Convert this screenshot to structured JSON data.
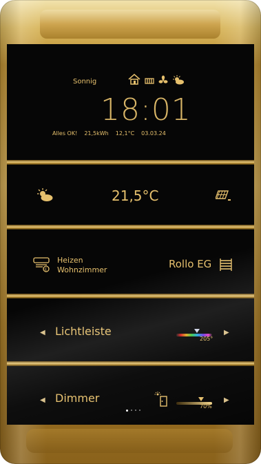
{
  "header": {
    "condition": "Sonnig",
    "time": "18:01",
    "status": "Alles OK!",
    "energy": "21,5kWh",
    "outdoor_temp": "12,1°C",
    "date": "03.03.24",
    "icons": [
      "home-icon",
      "heater-icon",
      "fan-icon",
      "partly-sunny-icon"
    ]
  },
  "climate": {
    "temperature": "21,5°C",
    "left_icon": "partly-sunny-icon",
    "right_icon": "solar-panel-icon"
  },
  "controls": {
    "heating_label_line1": "Heizen",
    "heating_label_line2": "Wohnzimmer",
    "shutter_label": "Rollo EG",
    "heating_icon": "heating-icon",
    "shutter_icon": "shutter-icon"
  },
  "light_strip": {
    "label": "Lichtleiste",
    "value": "205°",
    "hue_fraction": 0.57
  },
  "dimmer": {
    "label": "Dimmer",
    "value": "70%",
    "level_fraction": 0.7,
    "icon": "door-light-icon"
  },
  "pagination": {
    "pages": 4,
    "active": 0
  },
  "colors": {
    "accent": "#e6c06d",
    "screen": "#060606",
    "gold": "#c99d48"
  }
}
